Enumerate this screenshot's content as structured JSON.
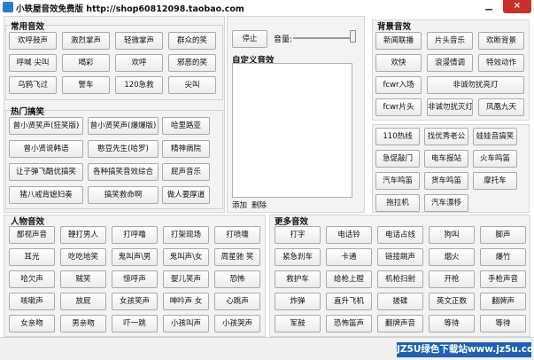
{
  "title": "小轶屋音效免费版 http://shop60812098.taobao.com",
  "window": {
    "minimize": "▁",
    "close": "×"
  },
  "common": {
    "title": "常用音效",
    "buttons": [
      "欢呼鼓声",
      "激烈掌声",
      "轻微掌声",
      "群众的笑",
      "呼喊 尖叫",
      "喝彩",
      "欢呼",
      "邪恶的笑",
      "乌鸦飞过",
      "警车",
      "120急救",
      "尖叫"
    ]
  },
  "funny": {
    "title": "热门搞笑",
    "buttons": [
      "曾小贤笑声(狂笑版)",
      "曾小贤笑声(爆爆版)",
      "哈里路亚",
      "曾小贤说韩语",
      "憨豆先生(哈罗)",
      "精神病院",
      "让子弹飞酷优搞笑",
      "各种搞笑音效综合",
      "屁声音乐",
      "猪八戒背媳妇奏",
      "搞笑救命啊",
      "做人要厚道"
    ]
  },
  "center": {
    "stop": "停止",
    "volume_label": "音量:",
    "volume": 0.95,
    "custom_title": "自定义音效",
    "add": "添加",
    "delete": "删除"
  },
  "background": {
    "title": "背景音效",
    "row1": [
      "新闻联播",
      "片头音乐",
      "欢断背景"
    ],
    "row2": [
      "欢快",
      "浪漫情调",
      "特效动作"
    ],
    "row3": [
      "fcwr入场",
      "非诚勿扰亮灯"
    ],
    "row4": [
      "fcwr片头",
      "非诚勿扰灭灯",
      "凤凰九天"
    ]
  },
  "misc": {
    "buttons": [
      "110热线",
      "找优秀老公",
      "娃娃音搞笑",
      "急促敲门",
      "电车报站",
      "火车鸣笛",
      "汽车鸣笛",
      "货车鸣笛",
      "摩托车",
      "拖拉机",
      "汽车漂移"
    ]
  },
  "people": {
    "title": "人物音效",
    "buttons": [
      "鄙视声音",
      "鞭打男人",
      "打呼噜",
      "打架现场",
      "打喷嚏",
      "耳光",
      "吃吃地笑",
      "鬼叫声\\男",
      "鬼叫声\\女",
      "周星驰 笑",
      "哈欠声",
      "贼笑",
      "惊呼声",
      "婴儿笑声",
      "恐怖",
      "咳嗽声",
      "放屁",
      "女孩笑声",
      "呻吟声 女",
      "心跳声",
      "女亲吻",
      "男亲吻",
      "吓一跳",
      "小孩叫声",
      "小孩哭声"
    ]
  },
  "more": {
    "title": "更多音效",
    "buttons": [
      "打字",
      "电话铃",
      "电话占线",
      "狗叫",
      "脚声",
      "紧急刹车",
      "卡通",
      "链接跳声",
      "烟火",
      "爆竹",
      "救护车",
      "给枪上膛",
      "机枪扫射",
      "开枪",
      "手枪声音",
      "炸弹",
      "直升飞机",
      "搓碟",
      "英文正数",
      "翻牌声",
      "军鼓",
      "恐怖笛声",
      "翻牌声音",
      "等待",
      "等待"
    ]
  },
  "watermark": "JZ5U绿色下载站www.jz5u.com"
}
